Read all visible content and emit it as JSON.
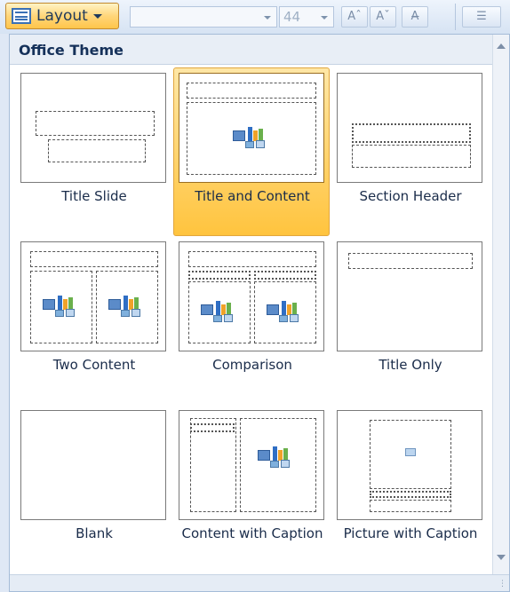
{
  "ribbon": {
    "layout_button": "Layout",
    "font_size": "44",
    "grow_font": "Aˆ",
    "shrink_font": "Aˇ",
    "clear_format": "A̶"
  },
  "gallery": {
    "section_title": "Office Theme",
    "layouts": [
      {
        "label": "Title Slide"
      },
      {
        "label": "Title and Content",
        "selected": true
      },
      {
        "label": "Section Header"
      },
      {
        "label": "Two Content"
      },
      {
        "label": "Comparison"
      },
      {
        "label": "Title Only"
      },
      {
        "label": "Blank"
      },
      {
        "label": "Content with Caption"
      },
      {
        "label": "Picture with Caption"
      }
    ]
  },
  "colors": {
    "selected_gradient_top": "#ffe7a6",
    "selected_gradient_bottom": "#ffc43e",
    "header_text": "#15315a",
    "label_text": "#1a2c4a"
  }
}
